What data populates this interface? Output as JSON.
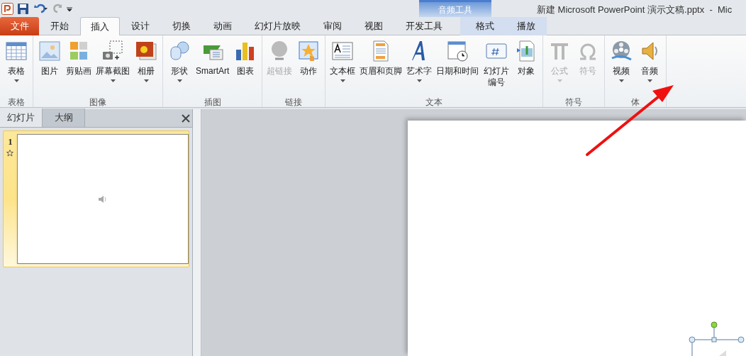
{
  "window": {
    "title": "新建 Microsoft PowerPoint 演示文稿.pptx  -  Mic"
  },
  "contextual_group": {
    "title": "音频工具"
  },
  "tabs": [
    {
      "label": "文件",
      "kind": "file",
      "selected": false
    },
    {
      "label": "开始",
      "kind": "normal",
      "selected": false
    },
    {
      "label": "插入",
      "kind": "normal",
      "selected": true
    },
    {
      "label": "设计",
      "kind": "normal",
      "selected": false
    },
    {
      "label": "切换",
      "kind": "normal",
      "selected": false
    },
    {
      "label": "动画",
      "kind": "normal",
      "selected": false
    },
    {
      "label": "幻灯片放映",
      "kind": "normal",
      "selected": false
    },
    {
      "label": "审阅",
      "kind": "normal",
      "selected": false
    },
    {
      "label": "视图",
      "kind": "normal",
      "selected": false
    },
    {
      "label": "开发工具",
      "kind": "normal",
      "selected": false
    },
    {
      "label": "格式",
      "kind": "contextual",
      "selected": false
    },
    {
      "label": "播放",
      "kind": "contextual",
      "selected": false
    }
  ],
  "ribbon_groups": [
    {
      "label": "表格",
      "buttons": [
        {
          "label": "表格",
          "has_menu": true,
          "disabled": false
        }
      ]
    },
    {
      "label": "图像",
      "buttons": [
        {
          "label": "图片",
          "has_menu": false,
          "disabled": false
        },
        {
          "label": "剪贴画",
          "has_menu": false,
          "disabled": false
        },
        {
          "label": "屏幕截图",
          "has_menu": true,
          "disabled": false
        },
        {
          "label": "相册",
          "has_menu": true,
          "disabled": false
        }
      ]
    },
    {
      "label": "插图",
      "buttons": [
        {
          "label": "形状",
          "has_menu": true,
          "disabled": false
        },
        {
          "label": "SmartArt",
          "has_menu": false,
          "disabled": false
        },
        {
          "label": "图表",
          "has_menu": false,
          "disabled": false
        }
      ]
    },
    {
      "label": "链接",
      "buttons": [
        {
          "label": "超链接",
          "has_menu": false,
          "disabled": true
        },
        {
          "label": "动作",
          "has_menu": false,
          "disabled": false
        }
      ]
    },
    {
      "label": "文本",
      "buttons": [
        {
          "label": "文本框",
          "has_menu": true,
          "disabled": false
        },
        {
          "label": "页眉和页脚",
          "has_menu": false,
          "disabled": false
        },
        {
          "label": "艺术字",
          "has_menu": true,
          "disabled": false
        },
        {
          "label": "日期和时间",
          "has_menu": false,
          "disabled": false
        },
        {
          "label": "幻灯片编号",
          "has_menu": false,
          "disabled": false,
          "wrap": true
        },
        {
          "label": "对象",
          "has_menu": false,
          "disabled": false
        }
      ]
    },
    {
      "label": "符号",
      "buttons": [
        {
          "label": "公式",
          "has_menu": true,
          "disabled": true
        },
        {
          "label": "符号",
          "has_menu": false,
          "disabled": true
        }
      ]
    },
    {
      "label": "体",
      "buttons": [
        {
          "label": "视频",
          "has_menu": true,
          "disabled": false
        },
        {
          "label": "音频",
          "has_menu": true,
          "disabled": false
        }
      ]
    }
  ],
  "pane_tabs": [
    {
      "label": "幻灯片",
      "selected": true
    },
    {
      "label": "大纲",
      "selected": false
    }
  ],
  "slides": [
    {
      "number": "1",
      "selected": true
    }
  ]
}
